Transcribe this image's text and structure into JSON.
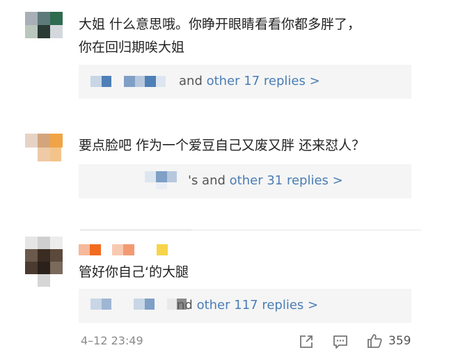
{
  "comments": [
    {
      "text_line1": "大姐 什么意思哦。你睁开眼睛看看你都多胖了，",
      "text_line2": "你在回归期唉大姐",
      "reply_summary": {
        "suffix": "and",
        "link": "other 17 replies >"
      }
    },
    {
      "text_line1": "要点脸吧 作为一个爱豆自己又废又胖 还来怼人？",
      "reply_summary": {
        "suffix": "'s and",
        "link": "other 31 replies >"
      }
    },
    {
      "text_line1": "管好你自己‘的大腿",
      "reply_summary": {
        "suffix": "nd",
        "link": "other 117 replies >"
      }
    }
  ],
  "footer": {
    "timestamp": "4–12 23:49",
    "like_count": "359",
    "icons": [
      "share-icon",
      "comment-icon",
      "like-icon"
    ]
  },
  "colors": {
    "link": "#4a7db5",
    "reply_bg": "#f5f5f5",
    "muted_text": "#8a8a8a"
  }
}
